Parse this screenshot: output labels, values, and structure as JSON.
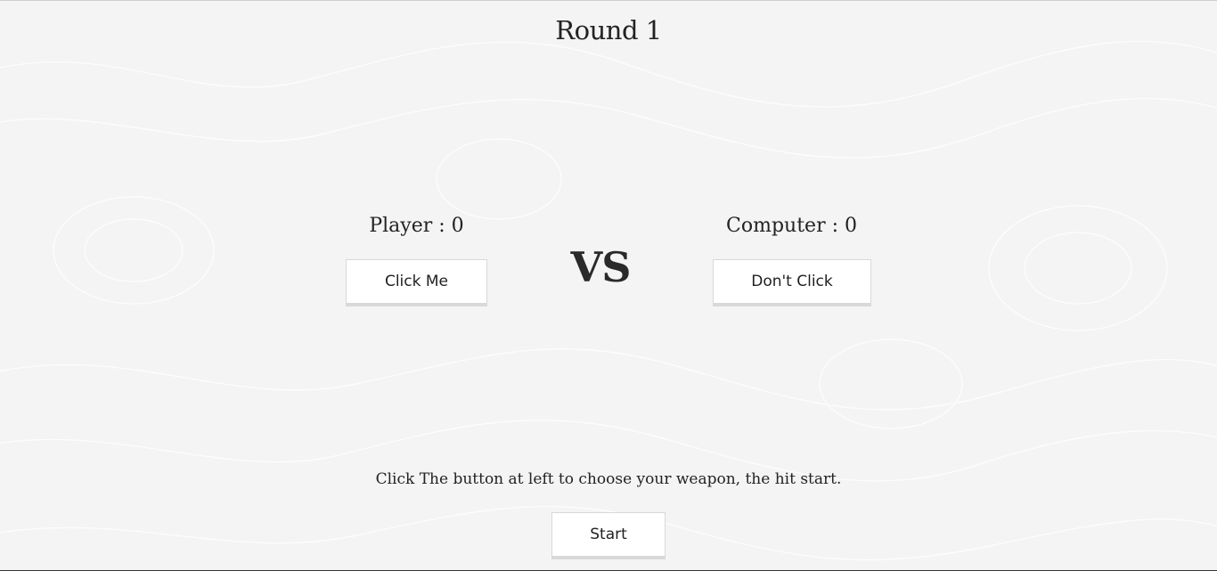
{
  "round": {
    "label": "Round 1"
  },
  "player": {
    "score_label": "Player : 0",
    "button_label": "Click Me"
  },
  "computer": {
    "score_label": "Computer : 0",
    "button_label": "Don't Click"
  },
  "versus": {
    "label": "VS"
  },
  "instruction": {
    "text": "Click The button at left to choose your weapon, the hit start."
  },
  "start": {
    "button_label": "Start"
  },
  "theme": {
    "background": "#f4f4f4",
    "text": "#222222",
    "button_bg": "#ffffff",
    "button_shadow": "#d9d9d9"
  }
}
